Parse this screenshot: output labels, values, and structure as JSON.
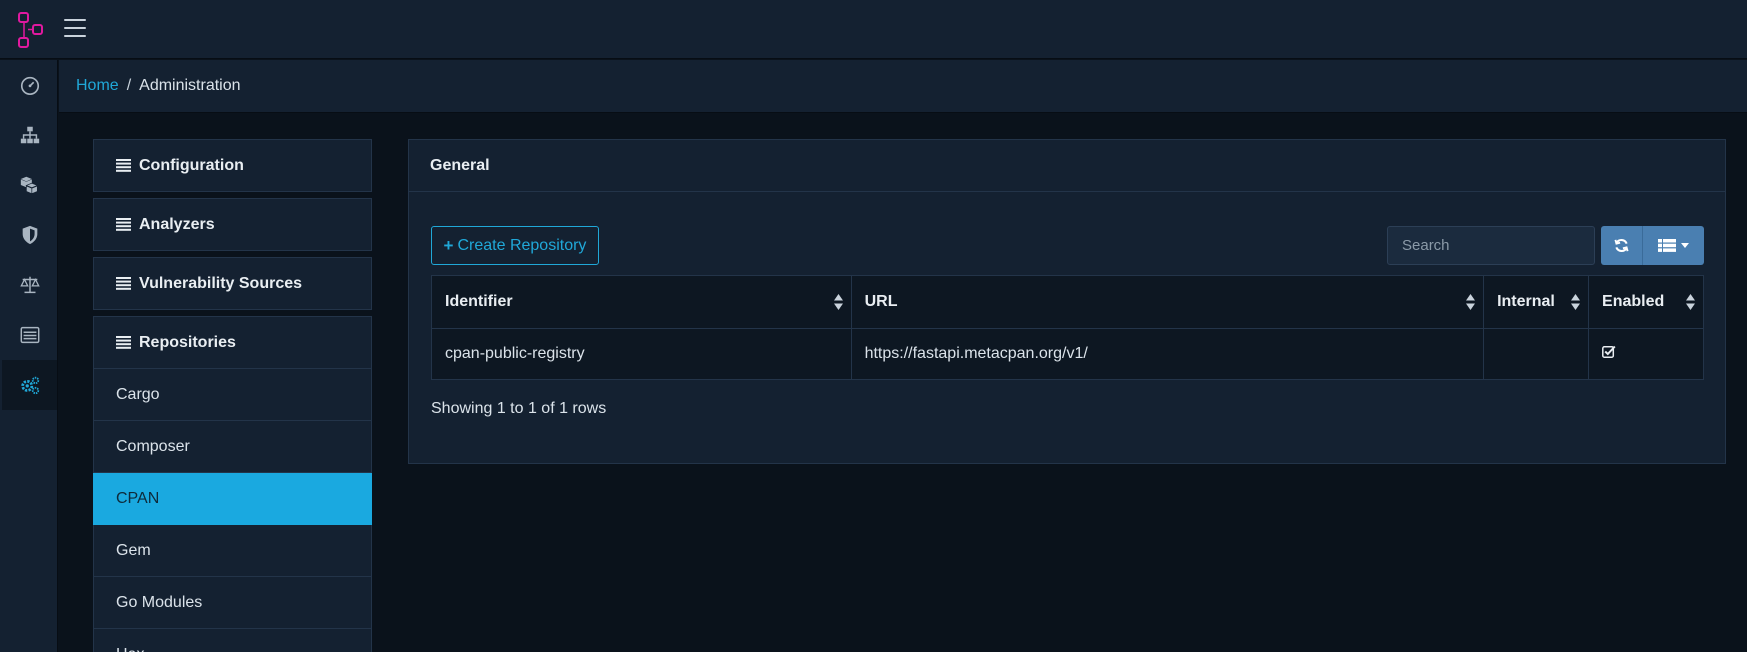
{
  "topbar": {
    "logo_icon": "app-logo-icon",
    "menu_icon": "hamburger-icon"
  },
  "sidebar": {
    "items": [
      {
        "icon": "dashboard-icon",
        "active": false
      },
      {
        "icon": "sitemap-icon",
        "active": false
      },
      {
        "icon": "components-icon",
        "active": false
      },
      {
        "icon": "shield-icon",
        "active": false
      },
      {
        "icon": "scale-icon",
        "active": false
      },
      {
        "icon": "list-icon",
        "active": false
      },
      {
        "icon": "gears-icon",
        "active": true
      }
    ]
  },
  "breadcrumb": {
    "home": "Home",
    "separator": "/",
    "current": "Administration"
  },
  "menu": {
    "sections": [
      "Configuration",
      "Analyzers",
      "Vulnerability Sources",
      "Repositories"
    ],
    "repository_items": [
      "Cargo",
      "Composer",
      "CPAN",
      "Gem",
      "Go Modules",
      "Hex"
    ],
    "active_item": "CPAN"
  },
  "card": {
    "title": "General",
    "create_button": "Create Repository",
    "search_placeholder": "Search",
    "columns": [
      "Identifier",
      "URL",
      "Internal",
      "Enabled"
    ],
    "rows": [
      {
        "identifier": "cpan-public-registry",
        "url": "https://fastapi.metacpan.org/v1/",
        "internal": "",
        "enabled": true
      }
    ],
    "footer": "Showing 1 to 1 of 1 rows"
  },
  "colors": {
    "accent": "#20a8d8",
    "active_bg": "#1aa9e0",
    "logo": "#e0199f",
    "button_group": "#4a7fb1"
  }
}
